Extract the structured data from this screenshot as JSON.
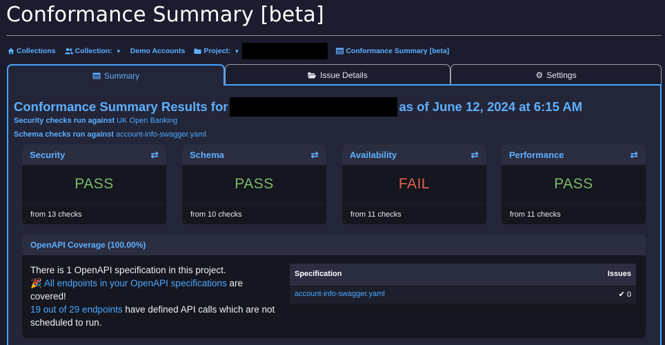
{
  "page": {
    "title": "Conformance Summary [beta]"
  },
  "breadcrumb": {
    "collections": "Collections",
    "collection": "Collection:",
    "collection_name": "Demo Accounts",
    "project": "Project:",
    "current": "Conformance Summary [beta]"
  },
  "tabs": {
    "summary": "Summary",
    "issue_details": "Issue Details",
    "settings": "Settings"
  },
  "summary": {
    "title_prefix": "Conformance Summary Results for",
    "title_suffix": "as of June 12, 2024 at 6:15 AM",
    "security_line_prefix": "Security checks run against",
    "security_line_link": "UK Open Banking",
    "schema_line_prefix": "Schema checks run against",
    "schema_line_link": "account-info-swagger.yaml"
  },
  "cards": [
    {
      "title": "Security",
      "result": "PASS",
      "footer": "from 13 checks",
      "status_color": "#7ab96a"
    },
    {
      "title": "Schema",
      "result": "PASS",
      "footer": "from 10 checks",
      "status_color": "#7ab96a"
    },
    {
      "title": "Availability",
      "result": "FAIL",
      "footer": "from 11 checks",
      "status_color": "#e0624f"
    },
    {
      "title": "Performance",
      "result": "PASS",
      "footer": "from 11 checks",
      "status_color": "#7ab96a"
    }
  ],
  "coverage": {
    "title": "OpenAPI Coverage (100.00%)",
    "line1": "There is 1 OpenAPI specification in this project.",
    "line2_emoji": "🎉",
    "line2_link": "All endpoints in your OpenAPI specifications",
    "line2_rest": "are covered!",
    "line3_link": "19 out of 29 endpoints",
    "line3_rest": "have defined API calls which are not scheduled to run.",
    "table": {
      "headers": {
        "specification": "Specification",
        "issues": "Issues"
      },
      "rows": [
        {
          "specification": "account-info-swagger.yaml",
          "issues": "0"
        }
      ]
    }
  },
  "colors": {
    "accent": "#46a3ff",
    "link": "#4ea8ff",
    "pass": "#7ab96a",
    "fail": "#e0624f",
    "background": "#1b1d2e"
  },
  "icons": {
    "collections": "home-icon",
    "collection": "users-icon",
    "project": "folder-icon",
    "current": "table-icon",
    "summary_tab": "table-icon",
    "issue_tab": "folder-open-icon",
    "settings_tab": "gear-icon",
    "card_action": "refresh-icon",
    "check": "check-icon"
  }
}
